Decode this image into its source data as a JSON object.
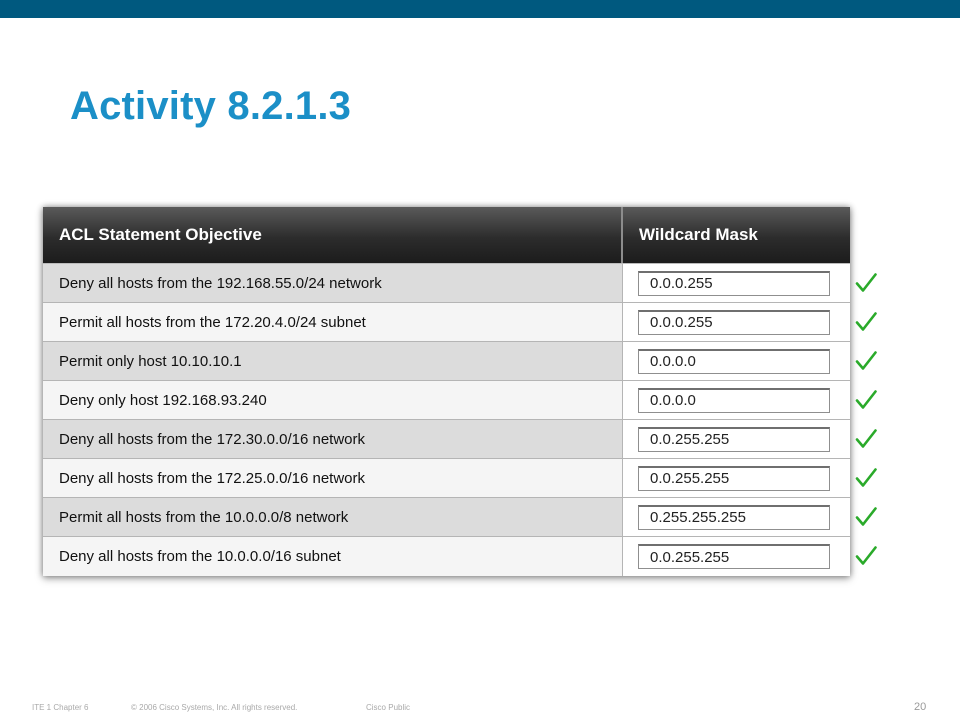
{
  "title": "Activity 8.2.1.3",
  "table": {
    "headers": {
      "objective": "ACL Statement Objective",
      "mask": "Wildcard Mask"
    },
    "rows": [
      {
        "objective": "Deny all hosts from the 192.168.55.0/24 network",
        "mask": "0.0.0.255",
        "status": "correct"
      },
      {
        "objective": "Permit all hosts from the 172.20.4.0/24 subnet",
        "mask": "0.0.0.255",
        "status": "correct"
      },
      {
        "objective": "Permit only host 10.10.10.1",
        "mask": "0.0.0.0",
        "status": "correct"
      },
      {
        "objective": "Deny only host 192.168.93.240",
        "mask": "0.0.0.0",
        "status": "correct"
      },
      {
        "objective": "Deny all hosts from the 172.30.0.0/16 network",
        "mask": "0.0.255.255",
        "status": "correct"
      },
      {
        "objective": "Deny all hosts from the 172.25.0.0/16 network",
        "mask": "0.0.255.255",
        "status": "correct"
      },
      {
        "objective": "Permit all hosts from the 10.0.0.0/8 network",
        "mask": "0.255.255.255",
        "status": "correct"
      },
      {
        "objective": "Deny all hosts from the 10.0.0.0/16 subnet",
        "mask": "0.0.255.255",
        "status": "correct"
      }
    ]
  },
  "footer": {
    "course": "ITE 1 Chapter 6",
    "copyright": "© 2006 Cisco Systems, Inc. All rights reserved.",
    "classification": "Cisco Public",
    "page_number": "20"
  },
  "colors": {
    "top_bar": "#00597f",
    "title": "#1b8fc7",
    "check": "#2aaa2a"
  },
  "icons": {
    "status_correct": "check-icon"
  }
}
